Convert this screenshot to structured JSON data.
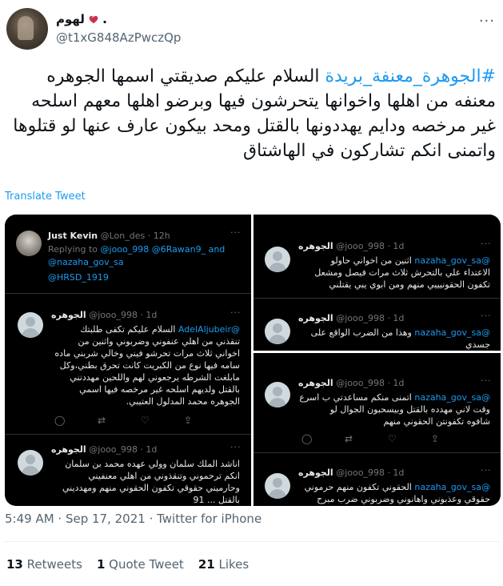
{
  "author": {
    "display_name": "لهوم",
    "dot": ".",
    "handle": "@t1xG848AzPwczQp"
  },
  "tweet": {
    "hashtag": "#الجوهرة_معنفة_بريدة",
    "body": " السلام عليكم صديقتي اسمها الجوهره معنفه من اهلها واخوانها يتحرشون فيها وبرضو اهلها معهم اسلحه غير مرخصه ودايم يهددونها بالقتل ومحد بيكون عارف عنها لو قتلوها واتمنى انكم تشاركون في الهاشتاق",
    "translate_label": "Translate Tweet"
  },
  "media": {
    "left": {
      "kevin": {
        "name": "Just Kevin",
        "handle_time": "@Lon_des · 12h",
        "replying_prefix": "Replying to",
        "replying_to_1": "@jooo_998 @6Rawan9_ and",
        "replying_to_2": "@nazaha_gov_sa",
        "replying_to_3": "@HRSD_1919"
      },
      "reply1": {
        "name": "الجوهره",
        "handle_time": "@jooo_998 · 1d",
        "mention": "@AdelAljubeir",
        "lines": [
          "السلام عليكم تكفى طلبتك",
          "تنقذني من اهلي عنفوني وضربوني واثنين من",
          "اخواني ثلاث مرات تحرشو فيني وخالي شربني ماده",
          "سامه فيها نوع من الكبريت كانت تحرق بطني،وكل",
          "مابلغت الشرطه يرجعوني لهم واللحين مهددنني",
          "بالقتل ولديهم اسلحه غير مرخصه فيها اسمي",
          "الجوهره محمد المدلول العتيبي."
        ]
      },
      "reply2": {
        "name": "الجوهره",
        "handle_time": "@jooo_998 · 1d",
        "lines": [
          "اناشد الملك سلمان وولي عهده محمد بن سلمان",
          "انكم ترحموني وتنقذوني من اهلي معنفيني",
          "وحارميني حقوقي تكفون الحقوني منهم ومهدديني",
          "بالقتل ... 91"
        ]
      }
    },
    "right_top": {
      "reply1": {
        "name": "الجوهره",
        "handle_time": "@jooo_998 · 1d",
        "mention": "@nazaha_gov_sa",
        "lines": [
          "اثنين من اخواني حاولو",
          "الاعتداء علي بالتحرش ثلاث مرات فيصل ومشعل",
          "تكفون الحقونيييي منهم ومن ابوي يبي يقتلني"
        ]
      },
      "reply2": {
        "name": "الجوهره",
        "handle_time": "@jooo_998 · 1d",
        "mention": "@nazaha_gov_sa",
        "lines": [
          "وهذا من الضرب الواقع على",
          "جسدي"
        ]
      }
    },
    "right_bottom": {
      "reply1": {
        "name": "الجوهره",
        "handle_time": "@jooo_998 · 1d",
        "mention": "@nazaha_gov_sa",
        "lines": [
          "اتمنى منكم مساعدتي ب اسرع",
          "وقت لاني مهدده بالقتل وبيسحبون الجوال لو",
          "شافوه تكفونتن الحقوني منهم"
        ]
      },
      "reply2": {
        "name": "الجوهره",
        "handle_time": "@jooo_998 · 1d",
        "mention": "@nazaha_gov_sa",
        "lines": [
          "الحقوني تكفون منهم حرموني",
          "حقوقي وعذبوني واهانوني وضربوني ضرب مبرح"
        ]
      }
    }
  },
  "meta": {
    "time": "5:49 AM · Sep 17, 2021 · Twitter for iPhone"
  },
  "stats": {
    "retweets_count": "13",
    "retweets_label": "Retweets",
    "quotes_count": "1",
    "quotes_label": "Quote Tweet",
    "likes_count": "21",
    "likes_label": "Likes"
  },
  "colors": {
    "link": "#1d9bf0",
    "secondary": "#536471"
  },
  "icons": [
    "heart-icon",
    "more-icon",
    "reply-icon",
    "retweet-icon",
    "like-icon",
    "share-icon"
  ]
}
